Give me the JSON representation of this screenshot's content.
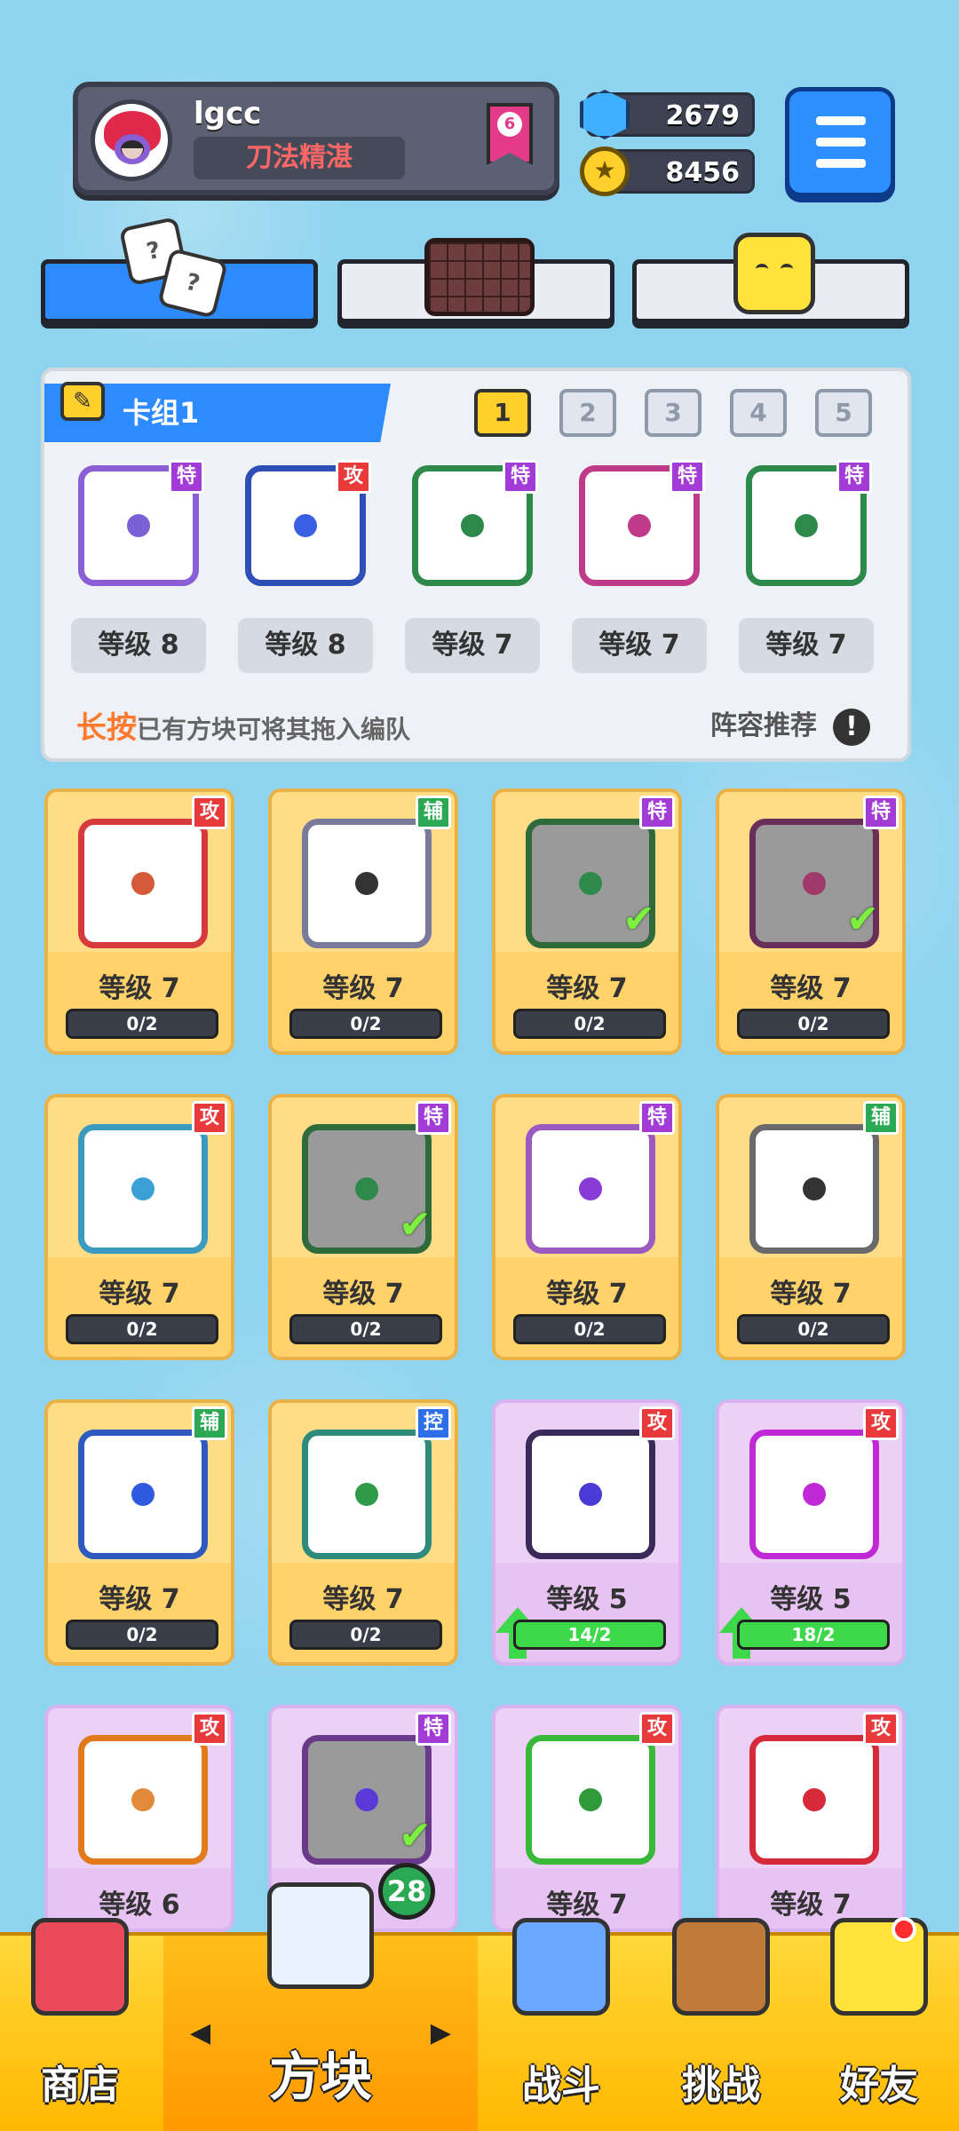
{
  "profile": {
    "name": "lgcc",
    "title": "刀法精湛",
    "rank": "6"
  },
  "currency": {
    "gems": "2679",
    "coins": "8456"
  },
  "deck": {
    "title": "卡组1",
    "tabs": [
      "1",
      "2",
      "3",
      "4",
      "5"
    ],
    "active_tab": "1",
    "cards": [
      {
        "tag": "特",
        "level": "等级 8",
        "color": "#8a5fd6",
        "pip": "#7b5fd6"
      },
      {
        "tag": "攻",
        "level": "等级 8",
        "color": "#2e4fb8",
        "pip": "#3a5fe0"
      },
      {
        "tag": "特",
        "level": "等级 7",
        "color": "#2e8a4a",
        "pip": "#2e8a4a"
      },
      {
        "tag": "特",
        "level": "等级 7",
        "color": "#c03a8a",
        "pip": "#c03a8a"
      },
      {
        "tag": "特",
        "level": "等级 7",
        "color": "#2e8a4a",
        "pip": "#2e8a4a"
      }
    ],
    "hint_key": "长按",
    "hint_text": "已有方块可将其拖入编队",
    "recommend": "阵容推荐",
    "recommend_icon": "!"
  },
  "collection": [
    {
      "tag": "攻",
      "level": "等级 7",
      "progress": "0/2",
      "frame": "#d63a3a",
      "pip": "#d65a3a",
      "dim": false,
      "check": false,
      "purple": false
    },
    {
      "tag": "辅",
      "level": "等级 7",
      "progress": "0/2",
      "frame": "#7a7a9a",
      "pip": "#333",
      "dim": false,
      "check": false,
      "purple": false
    },
    {
      "tag": "特",
      "level": "等级 7",
      "progress": "0/2",
      "frame": "#2e6a3a",
      "pip": "#2e8a4a",
      "dim": true,
      "check": true,
      "purple": false
    },
    {
      "tag": "特",
      "level": "等级 7",
      "progress": "0/2",
      "frame": "#6a2e5a",
      "pip": "#a03a6a",
      "dim": true,
      "check": true,
      "purple": false
    },
    {
      "tag": "攻",
      "level": "等级 7",
      "progress": "0/2",
      "frame": "#3a9ac0",
      "pip": "#3aa0d6",
      "dim": false,
      "check": false,
      "purple": false
    },
    {
      "tag": "特",
      "level": "等级 7",
      "progress": "0/2",
      "frame": "#2e6a3a",
      "pip": "#2e8a4a",
      "dim": true,
      "check": true,
      "purple": false
    },
    {
      "tag": "特",
      "level": "等级 7",
      "progress": "0/2",
      "frame": "#9a5ac0",
      "pip": "#8a3ad6",
      "dim": false,
      "check": false,
      "purple": false
    },
    {
      "tag": "辅",
      "level": "等级 7",
      "progress": "0/2",
      "frame": "#6a6a6a",
      "pip": "#333",
      "dim": false,
      "check": false,
      "purple": false
    },
    {
      "tag": "辅",
      "level": "等级 7",
      "progress": "0/2",
      "frame": "#2e5ac0",
      "pip": "#2e5ae0",
      "dim": false,
      "check": false,
      "purple": false
    },
    {
      "tag": "控",
      "level": "等级 7",
      "progress": "0/2",
      "frame": "#2e8a7a",
      "pip": "#2e9a4a",
      "dim": false,
      "check": false,
      "purple": false
    },
    {
      "tag": "攻",
      "level": "等级 5",
      "progress": "14/2",
      "frame": "#3a2a5a",
      "pip": "#4a3ad6",
      "dim": false,
      "check": false,
      "purple": true
    },
    {
      "tag": "攻",
      "level": "等级 5",
      "progress": "18/2",
      "frame": "#c02ad6",
      "pip": "#c02ad6",
      "dim": false,
      "check": false,
      "purple": true
    },
    {
      "tag": "攻",
      "level": "等级 6",
      "progress": "",
      "frame": "#e07a1a",
      "pip": "#e08a3a",
      "dim": false,
      "check": false,
      "purple": true
    },
    {
      "tag": "特",
      "level": "",
      "progress": "",
      "frame": "#6a3a8a",
      "pip": "#5a3ad6",
      "dim": true,
      "check": true,
      "purple": true
    },
    {
      "tag": "攻",
      "level": "等级 7",
      "progress": "",
      "frame": "#3ab83a",
      "pip": "#2e9a3a",
      "dim": false,
      "check": false,
      "purple": true
    },
    {
      "tag": "攻",
      "level": "等级 7",
      "progress": "",
      "frame": "#d62a3a",
      "pip": "#d62a3a",
      "dim": false,
      "check": false,
      "purple": true
    }
  ],
  "nav": {
    "shop": "商店",
    "blocks": "方块",
    "blocks_badge": "28",
    "battle": "战斗",
    "challenge": "挑战",
    "friends": "好友"
  }
}
